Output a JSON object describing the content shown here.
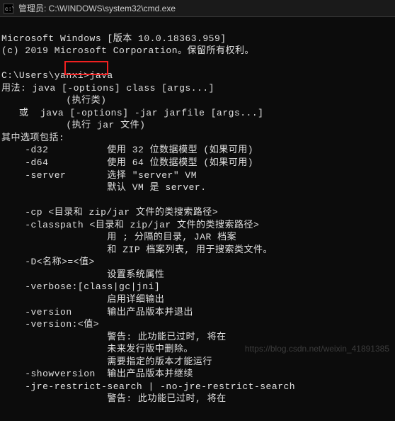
{
  "titlebar": {
    "icon_glyph": "▣",
    "title": "管理员: C:\\WINDOWS\\system32\\cmd.exe"
  },
  "lines": {
    "l0": "Microsoft Windows [版本 10.0.18363.959]",
    "l1": "(c) 2019 Microsoft Corporation。保留所有权利。",
    "l2": "",
    "l3": "C:\\Users\\yanxi>java",
    "l4": "用法: java [-options] class [args...]",
    "l5": "           (执行类)",
    "l6": "   或  java [-options] -jar jarfile [args...]",
    "l7": "           (执行 jar 文件)",
    "l8": "其中选项包括:",
    "l9": "    -d32          使用 32 位数据模型 (如果可用)",
    "l10": "    -d64          使用 64 位数据模型 (如果可用)",
    "l11": "    -server       选择 \"server\" VM",
    "l12": "                  默认 VM 是 server.",
    "l13": "",
    "l14": "    -cp <目录和 zip/jar 文件的类搜索路径>",
    "l15": "    -classpath <目录和 zip/jar 文件的类搜索路径>",
    "l16": "                  用 ; 分隔的目录, JAR 档案",
    "l17": "                  和 ZIP 档案列表, 用于搜索类文件。",
    "l18": "    -D<名称>=<值>",
    "l19": "                  设置系统属性",
    "l20": "    -verbose:[class|gc|jni]",
    "l21": "                  启用详细输出",
    "l22": "    -version      输出产品版本并退出",
    "l23": "    -version:<值>",
    "l24": "                  警告: 此功能已过时, 将在",
    "l25": "                  未来发行版中删除。",
    "l26": "                  需要指定的版本才能运行",
    "l27": "    -showversion  输出产品版本并继续",
    "l28": "    -jre-restrict-search | -no-jre-restrict-search",
    "l29": "                  警告: 此功能已过时, 将在"
  },
  "watermark": "https://blog.csdn.net/weixin_41891385"
}
